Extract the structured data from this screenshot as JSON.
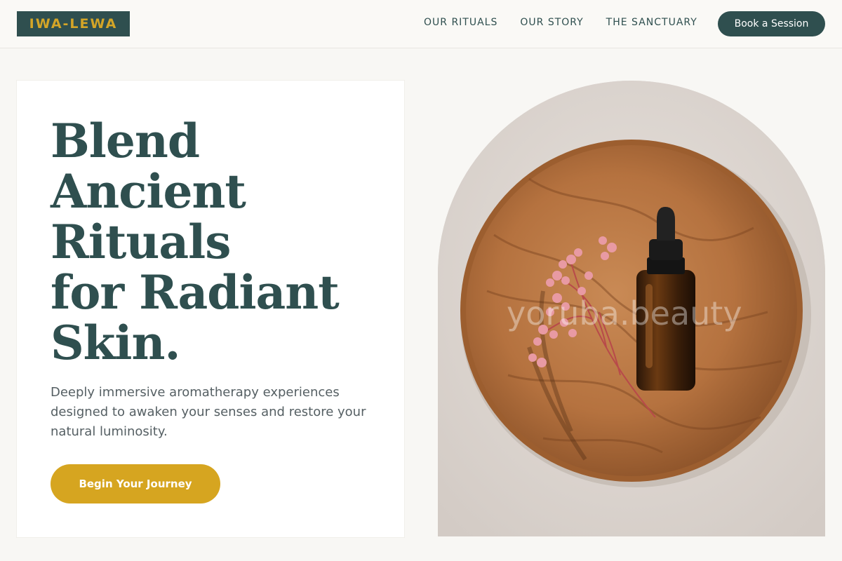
{
  "header": {
    "logo": "IWA-LEWA",
    "nav": [
      {
        "label": "OUR RITUALS"
      },
      {
        "label": "OUR STORY"
      },
      {
        "label": "THE SANCTUARY"
      }
    ],
    "book_label": "Book a Session"
  },
  "hero": {
    "title_lines": [
      "Blend",
      "Ancient",
      "Rituals",
      "for Radiant",
      "Skin."
    ],
    "subtitle": "Deeply immersive aromatherapy experiences designed to awaken your senses and restore your natural luminosity.",
    "cta_label": "Begin Your Journey",
    "image": {
      "description_icon": "serum-bottle-on-wooden-plate-photo",
      "watermark": "yoruba.beauty"
    }
  },
  "colors": {
    "primary": "#2f4f4f",
    "accent_gold": "#d6a520",
    "background": "#f8f7f4",
    "card": "#ffffff"
  }
}
